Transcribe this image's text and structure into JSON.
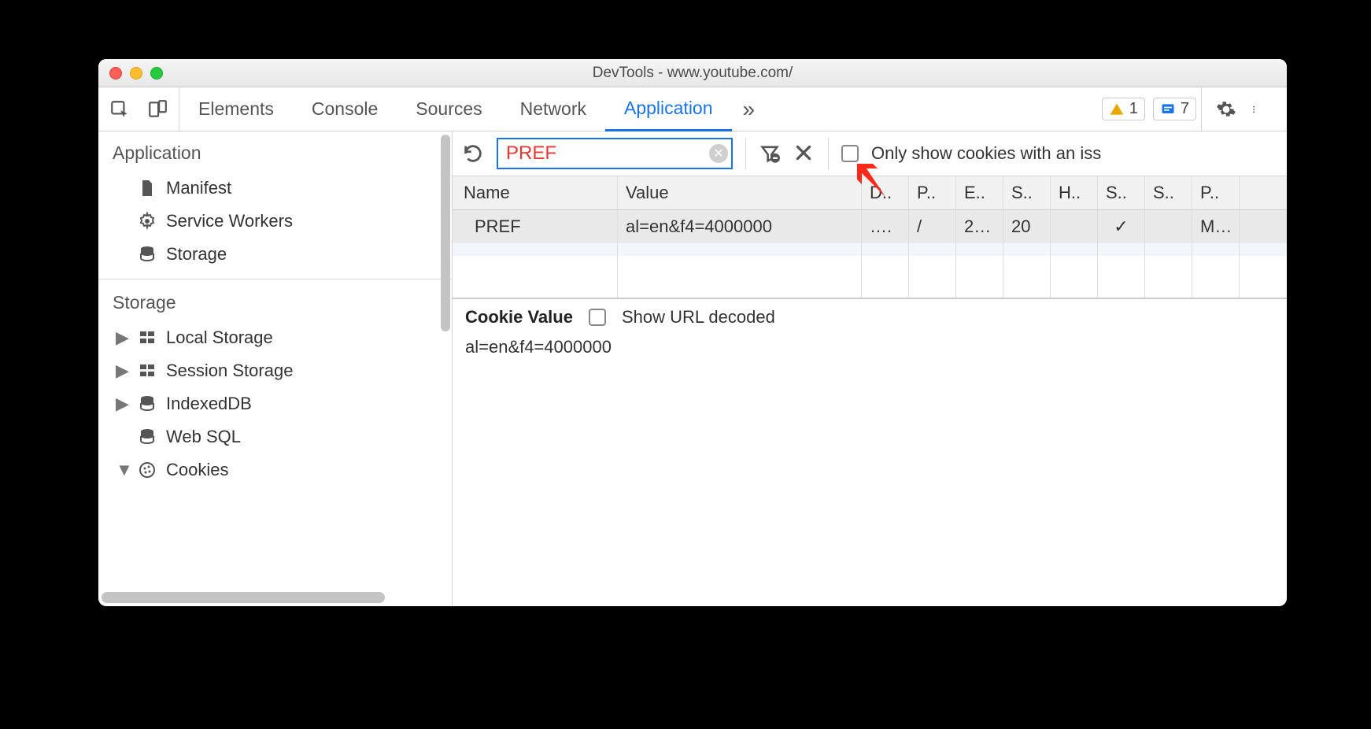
{
  "window": {
    "title": "DevTools - www.youtube.com/"
  },
  "tabs": {
    "items": [
      "Elements",
      "Console",
      "Sources",
      "Network",
      "Application"
    ],
    "active": "Application",
    "more_glyph": "»"
  },
  "badges": {
    "warning_count": "1",
    "message_count": "7"
  },
  "sidebar": {
    "sections": [
      {
        "title": "Application",
        "items": [
          {
            "label": "Manifest",
            "icon": "file-icon",
            "expandable": false
          },
          {
            "label": "Service Workers",
            "icon": "gear-icon",
            "expandable": false
          },
          {
            "label": "Storage",
            "icon": "db-icon",
            "expandable": false
          }
        ]
      },
      {
        "title": "Storage",
        "items": [
          {
            "label": "Local Storage",
            "icon": "grid-icon",
            "expandable": true,
            "expanded": false
          },
          {
            "label": "Session Storage",
            "icon": "grid-icon",
            "expandable": true,
            "expanded": false
          },
          {
            "label": "IndexedDB",
            "icon": "db-icon",
            "expandable": true,
            "expanded": false
          },
          {
            "label": "Web SQL",
            "icon": "db-icon",
            "expandable": false
          },
          {
            "label": "Cookies",
            "icon": "cookie-icon",
            "expandable": true,
            "expanded": true
          }
        ]
      }
    ]
  },
  "toolbar": {
    "filter_value": "PREF",
    "only_issues_label": "Only show cookies with an iss"
  },
  "table": {
    "headers": [
      "Name",
      "Value",
      "D..",
      "P..",
      "E..",
      "S..",
      "H..",
      "S..",
      "S..",
      "P.."
    ],
    "rows": [
      {
        "cells": [
          "PREF",
          "al=en&f4=4000000",
          "….",
          "/",
          "2…",
          "20",
          "",
          "✓",
          "",
          "M…"
        ],
        "selected": true
      }
    ]
  },
  "detail": {
    "title": "Cookie Value",
    "decode_label": "Show URL decoded",
    "value": "al=en&f4=4000000"
  }
}
